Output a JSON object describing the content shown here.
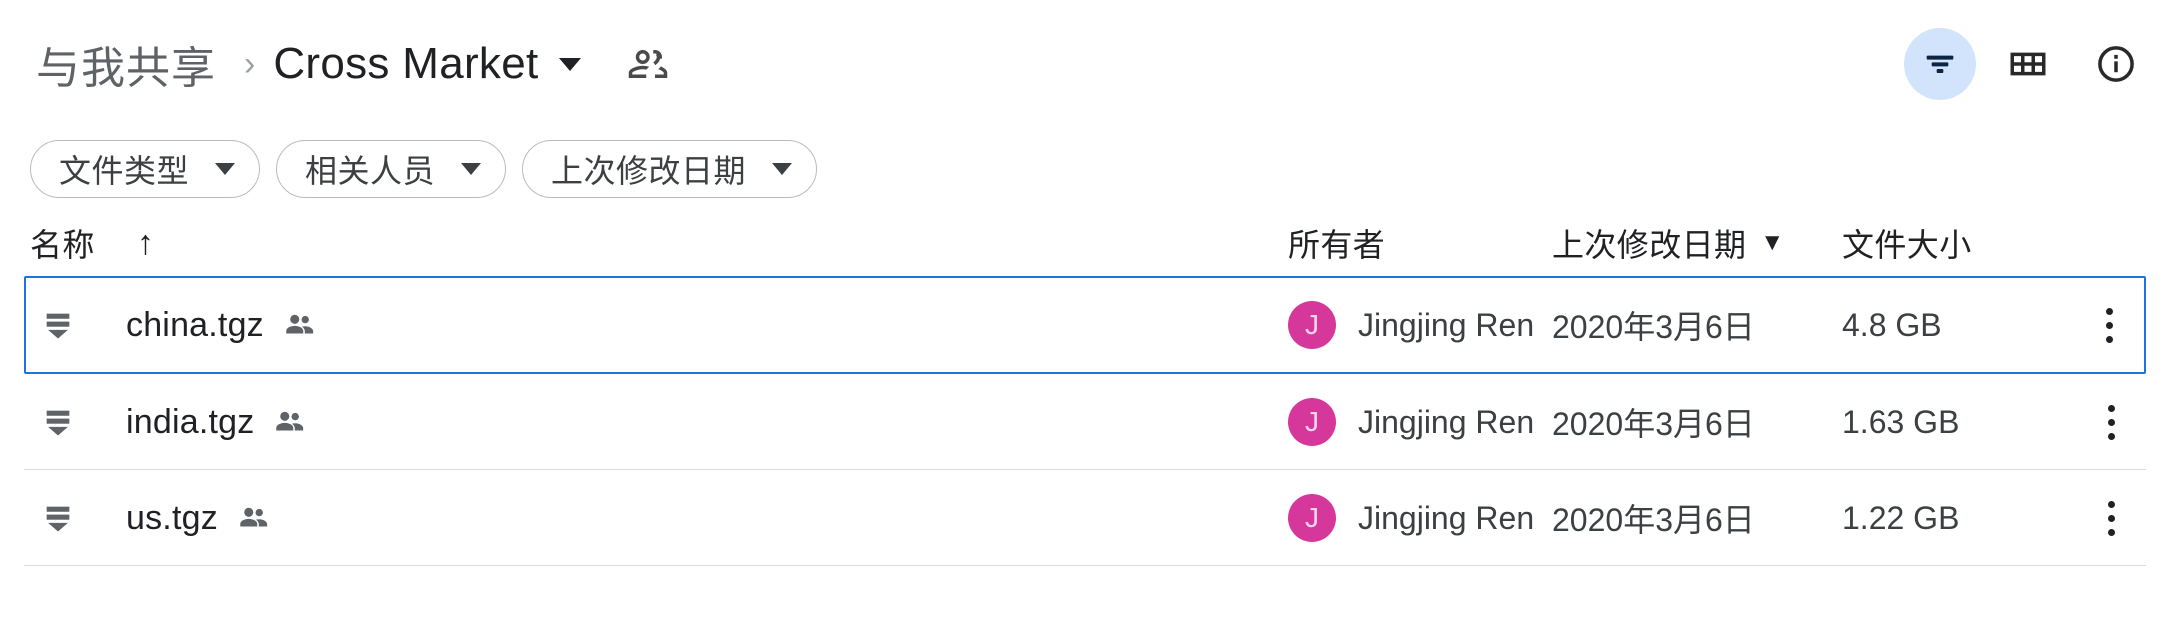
{
  "header": {
    "breadcrumb": {
      "root": "与我共享",
      "separator": "›",
      "current": "Cross Market",
      "current_caret": "▾",
      "shared_icon": "people-shared-icon"
    },
    "actions": [
      {
        "name": "filter-button",
        "icon": "filter-icon",
        "active": true
      },
      {
        "name": "grid-view-button",
        "icon": "grid-view-icon",
        "active": false
      },
      {
        "name": "details-info-button",
        "icon": "info-circle-icon",
        "active": false
      }
    ]
  },
  "filters": {
    "chips": [
      {
        "label": "文件类型",
        "caret": "▾"
      },
      {
        "label": "相关人员",
        "caret": "▾"
      },
      {
        "label": "上次修改日期",
        "caret": "▾"
      }
    ]
  },
  "table": {
    "columns": {
      "name": "名称",
      "name_sort": "↑",
      "owner": "所有者",
      "modified": "上次修改日期",
      "modified_sort": "▼",
      "size": "文件大小"
    },
    "rows": [
      {
        "name": "china.tgz",
        "file_icon": "archive-file-icon",
        "shared_icon": "people-shared-icon",
        "owner": "Jingjing Ren",
        "owner_initial": "J",
        "modified": "2020年3月6日",
        "size": "4.8 GB",
        "selected": true
      },
      {
        "name": "india.tgz",
        "file_icon": "archive-file-icon",
        "shared_icon": "people-shared-icon",
        "owner": "Jingjing Ren",
        "owner_initial": "J",
        "modified": "2020年3月6日",
        "size": "1.63 GB",
        "selected": false
      },
      {
        "name": "us.tgz",
        "file_icon": "archive-file-icon",
        "shared_icon": "people-shared-icon",
        "owner": "Jingjing Ren",
        "owner_initial": "J",
        "modified": "2020年3月6日",
        "size": "1.22 GB",
        "selected": false
      }
    ]
  },
  "colors": {
    "selection_border": "#1a73e8",
    "filter_active_bg": "#d2e3fc",
    "avatar_bg": "#d6379b",
    "divider": "#dadce0",
    "text_primary": "#202124",
    "text_secondary": "#3c4043",
    "breadcrumb_root": "#5f6368"
  }
}
